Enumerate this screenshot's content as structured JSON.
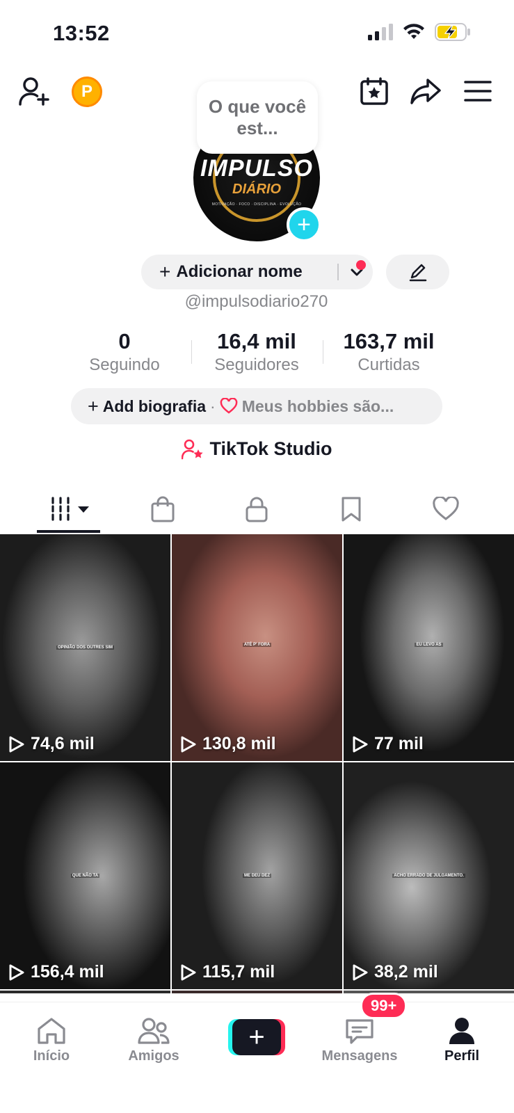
{
  "status_bar": {
    "time": "13:52"
  },
  "header": {
    "coin_letter": "P",
    "note_text": "O que você est..."
  },
  "profile": {
    "avatar_logo_line1": "IMPULSO",
    "avatar_logo_line2": "DIÁRIO",
    "avatar_logo_line3": "MOTIVAÇÃO · FOCO · DISCIPLINA · EVOLUÇÃO",
    "add_name_label": "Adicionar nome",
    "username": "@impulsodiario270",
    "stats": [
      {
        "value": "0",
        "label": "Seguindo"
      },
      {
        "value": "16,4 mil",
        "label": "Seguidores"
      },
      {
        "value": "163,7 mil",
        "label": "Curtidas"
      }
    ],
    "bio_add": "Add biografia",
    "bio_separator": "·",
    "bio_suggestion": "Meus hobbies são...",
    "studio_label": "TikTok Studio"
  },
  "tabs": [
    "videos-grid-icon",
    "shop-bag-icon",
    "lock-icon",
    "bookmark-icon",
    "heart-icon"
  ],
  "videos": [
    {
      "views": "74,6 mil",
      "caption": "OPINIÃO DOS OUTRES SIM"
    },
    {
      "views": "130,8 mil",
      "caption": "ATÉ P' FORA"
    },
    {
      "views": "77 mil",
      "caption": "EU LEVO AS"
    },
    {
      "views": "156,4 mil",
      "caption": "QUE NÃO TA"
    },
    {
      "views": "115,7 mil",
      "caption": "ME DEU DEZ"
    },
    {
      "views": "38,2 mil",
      "caption": "ACHO ERRADO DE JULGAMENTO."
    }
  ],
  "bottom_nav": {
    "home": "Início",
    "friends": "Amigos",
    "messages": "Mensagens",
    "messages_badge": "99+",
    "profile": "Perfil"
  },
  "colors": {
    "accent": "#fe2c55",
    "cyan": "#25f4ee",
    "text": "#161823",
    "muted": "#86878b"
  }
}
